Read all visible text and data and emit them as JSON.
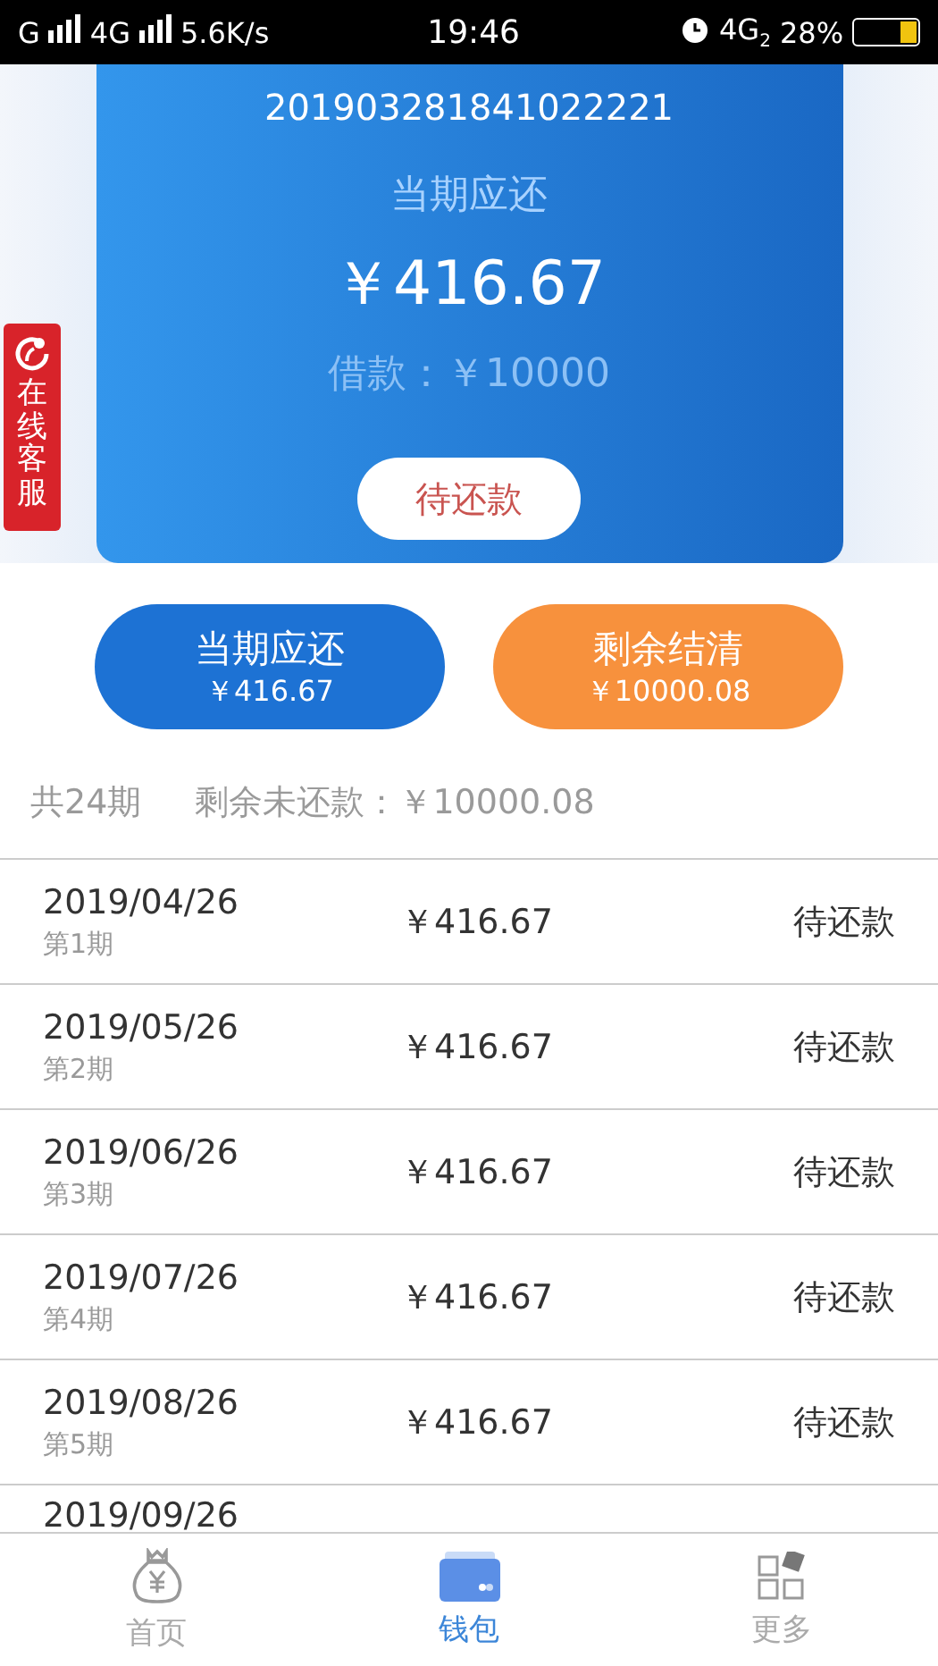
{
  "status_bar": {
    "carrier_1": "G",
    "carrier_2": "4G",
    "speed": "5.6K/s",
    "time": "19:46",
    "network": "4G",
    "network_sub": "2",
    "battery": "28%"
  },
  "loan_card": {
    "number": "201903281841022221",
    "label": "当期应还",
    "amount": "￥416.67",
    "principal": "借款：￥10000",
    "status_button": "待还款"
  },
  "service_tab": {
    "label": "在线客服"
  },
  "actions": [
    {
      "kind": "primary",
      "title": "当期应还",
      "amount": "￥416.67"
    },
    {
      "kind": "secondary",
      "title": "剩余结清",
      "amount": "￥10000.08"
    }
  ],
  "summary": {
    "periods": "共24期",
    "remaining": "剩余未还款：￥10000.08"
  },
  "schedule": [
    {
      "date": "2019/04/26",
      "period": "第1期",
      "amount": "￥416.67",
      "status": "待还款"
    },
    {
      "date": "2019/05/26",
      "period": "第2期",
      "amount": "￥416.67",
      "status": "待还款"
    },
    {
      "date": "2019/06/26",
      "period": "第3期",
      "amount": "￥416.67",
      "status": "待还款"
    },
    {
      "date": "2019/07/26",
      "period": "第4期",
      "amount": "￥416.67",
      "status": "待还款"
    },
    {
      "date": "2019/08/26",
      "period": "第5期",
      "amount": "￥416.67",
      "status": "待还款"
    },
    {
      "date": "2019/09/26"
    }
  ],
  "tab_bar": [
    {
      "kind": "home",
      "label": "首页",
      "selected": false
    },
    {
      "kind": "wallet",
      "label": "钱包",
      "selected": true
    },
    {
      "kind": "more",
      "label": "更多",
      "selected": false
    }
  ]
}
